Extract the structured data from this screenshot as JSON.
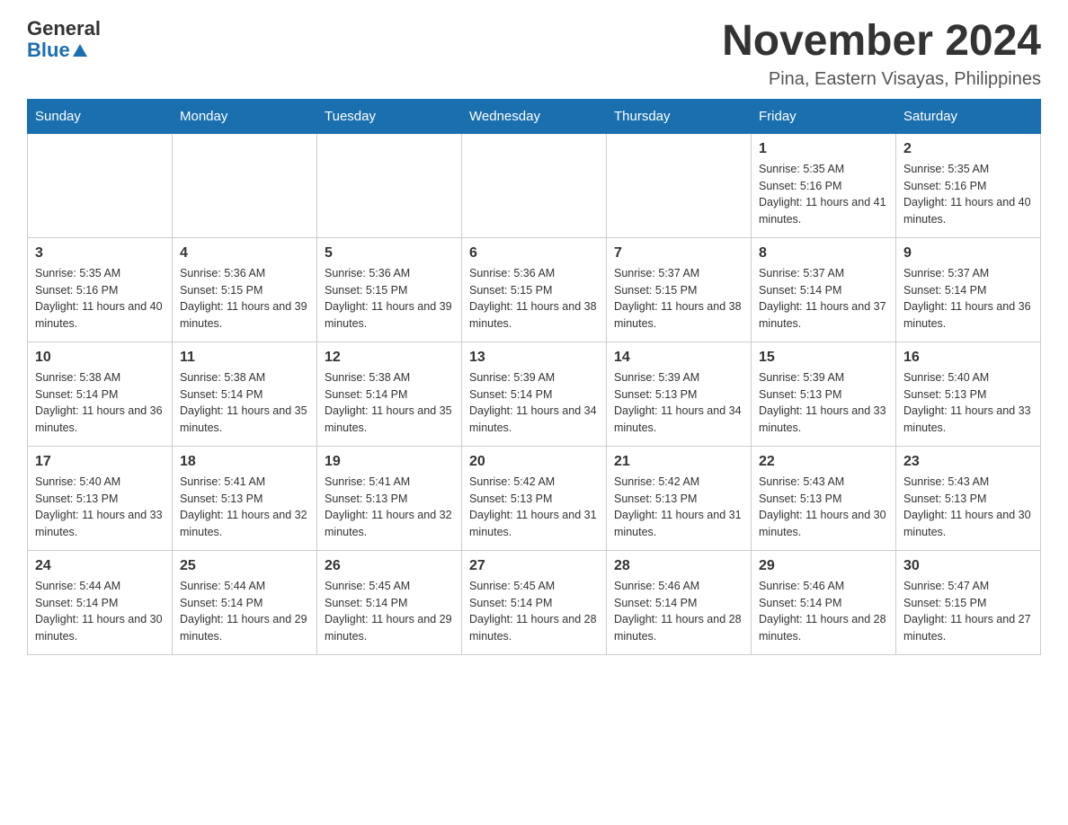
{
  "header": {
    "logo_line1": "General",
    "logo_line2": "Blue",
    "month_title": "November 2024",
    "location": "Pina, Eastern Visayas, Philippines"
  },
  "calendar": {
    "days_of_week": [
      "Sunday",
      "Monday",
      "Tuesday",
      "Wednesday",
      "Thursday",
      "Friday",
      "Saturday"
    ],
    "weeks": [
      [
        {
          "day": "",
          "info": ""
        },
        {
          "day": "",
          "info": ""
        },
        {
          "day": "",
          "info": ""
        },
        {
          "day": "",
          "info": ""
        },
        {
          "day": "",
          "info": ""
        },
        {
          "day": "1",
          "info": "Sunrise: 5:35 AM\nSunset: 5:16 PM\nDaylight: 11 hours and 41 minutes."
        },
        {
          "day": "2",
          "info": "Sunrise: 5:35 AM\nSunset: 5:16 PM\nDaylight: 11 hours and 40 minutes."
        }
      ],
      [
        {
          "day": "3",
          "info": "Sunrise: 5:35 AM\nSunset: 5:16 PM\nDaylight: 11 hours and 40 minutes."
        },
        {
          "day": "4",
          "info": "Sunrise: 5:36 AM\nSunset: 5:15 PM\nDaylight: 11 hours and 39 minutes."
        },
        {
          "day": "5",
          "info": "Sunrise: 5:36 AM\nSunset: 5:15 PM\nDaylight: 11 hours and 39 minutes."
        },
        {
          "day": "6",
          "info": "Sunrise: 5:36 AM\nSunset: 5:15 PM\nDaylight: 11 hours and 38 minutes."
        },
        {
          "day": "7",
          "info": "Sunrise: 5:37 AM\nSunset: 5:15 PM\nDaylight: 11 hours and 38 minutes."
        },
        {
          "day": "8",
          "info": "Sunrise: 5:37 AM\nSunset: 5:14 PM\nDaylight: 11 hours and 37 minutes."
        },
        {
          "day": "9",
          "info": "Sunrise: 5:37 AM\nSunset: 5:14 PM\nDaylight: 11 hours and 36 minutes."
        }
      ],
      [
        {
          "day": "10",
          "info": "Sunrise: 5:38 AM\nSunset: 5:14 PM\nDaylight: 11 hours and 36 minutes."
        },
        {
          "day": "11",
          "info": "Sunrise: 5:38 AM\nSunset: 5:14 PM\nDaylight: 11 hours and 35 minutes."
        },
        {
          "day": "12",
          "info": "Sunrise: 5:38 AM\nSunset: 5:14 PM\nDaylight: 11 hours and 35 minutes."
        },
        {
          "day": "13",
          "info": "Sunrise: 5:39 AM\nSunset: 5:14 PM\nDaylight: 11 hours and 34 minutes."
        },
        {
          "day": "14",
          "info": "Sunrise: 5:39 AM\nSunset: 5:13 PM\nDaylight: 11 hours and 34 minutes."
        },
        {
          "day": "15",
          "info": "Sunrise: 5:39 AM\nSunset: 5:13 PM\nDaylight: 11 hours and 33 minutes."
        },
        {
          "day": "16",
          "info": "Sunrise: 5:40 AM\nSunset: 5:13 PM\nDaylight: 11 hours and 33 minutes."
        }
      ],
      [
        {
          "day": "17",
          "info": "Sunrise: 5:40 AM\nSunset: 5:13 PM\nDaylight: 11 hours and 33 minutes."
        },
        {
          "day": "18",
          "info": "Sunrise: 5:41 AM\nSunset: 5:13 PM\nDaylight: 11 hours and 32 minutes."
        },
        {
          "day": "19",
          "info": "Sunrise: 5:41 AM\nSunset: 5:13 PM\nDaylight: 11 hours and 32 minutes."
        },
        {
          "day": "20",
          "info": "Sunrise: 5:42 AM\nSunset: 5:13 PM\nDaylight: 11 hours and 31 minutes."
        },
        {
          "day": "21",
          "info": "Sunrise: 5:42 AM\nSunset: 5:13 PM\nDaylight: 11 hours and 31 minutes."
        },
        {
          "day": "22",
          "info": "Sunrise: 5:43 AM\nSunset: 5:13 PM\nDaylight: 11 hours and 30 minutes."
        },
        {
          "day": "23",
          "info": "Sunrise: 5:43 AM\nSunset: 5:13 PM\nDaylight: 11 hours and 30 minutes."
        }
      ],
      [
        {
          "day": "24",
          "info": "Sunrise: 5:44 AM\nSunset: 5:14 PM\nDaylight: 11 hours and 30 minutes."
        },
        {
          "day": "25",
          "info": "Sunrise: 5:44 AM\nSunset: 5:14 PM\nDaylight: 11 hours and 29 minutes."
        },
        {
          "day": "26",
          "info": "Sunrise: 5:45 AM\nSunset: 5:14 PM\nDaylight: 11 hours and 29 minutes."
        },
        {
          "day": "27",
          "info": "Sunrise: 5:45 AM\nSunset: 5:14 PM\nDaylight: 11 hours and 28 minutes."
        },
        {
          "day": "28",
          "info": "Sunrise: 5:46 AM\nSunset: 5:14 PM\nDaylight: 11 hours and 28 minutes."
        },
        {
          "day": "29",
          "info": "Sunrise: 5:46 AM\nSunset: 5:14 PM\nDaylight: 11 hours and 28 minutes."
        },
        {
          "day": "30",
          "info": "Sunrise: 5:47 AM\nSunset: 5:15 PM\nDaylight: 11 hours and 27 minutes."
        }
      ]
    ]
  }
}
